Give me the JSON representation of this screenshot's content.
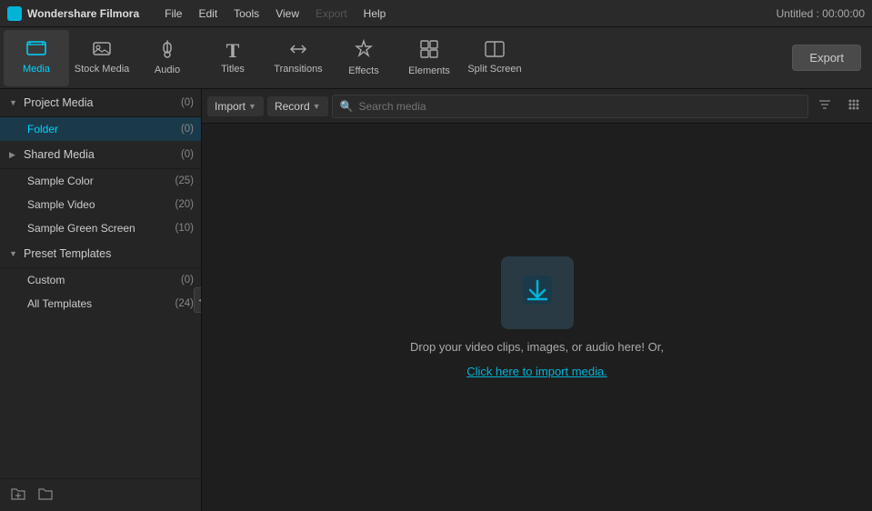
{
  "app": {
    "name": "Wondershare Filmora",
    "logo_color": "#00b4d8",
    "title": "Untitled : 00:00:00"
  },
  "menu": {
    "items": [
      "File",
      "Edit",
      "Tools",
      "View",
      "Export",
      "Help"
    ],
    "disabled": [
      "Export"
    ]
  },
  "toolbar": {
    "tools": [
      {
        "id": "media",
        "label": "Media",
        "icon": "🖥",
        "active": true
      },
      {
        "id": "stock-media",
        "label": "Stock Media",
        "icon": "📷",
        "active": false
      },
      {
        "id": "audio",
        "label": "Audio",
        "icon": "♪",
        "active": false
      },
      {
        "id": "titles",
        "label": "Titles",
        "icon": "T",
        "active": false
      },
      {
        "id": "transitions",
        "label": "Transitions",
        "icon": "↔",
        "active": false
      },
      {
        "id": "effects",
        "label": "Effects",
        "icon": "✦",
        "active": false
      },
      {
        "id": "elements",
        "label": "Elements",
        "icon": "◈",
        "active": false
      },
      {
        "id": "split-screen",
        "label": "Split Screen",
        "icon": "⊟",
        "active": false
      }
    ],
    "export_label": "Export"
  },
  "sidebar": {
    "sections": [
      {
        "id": "project-media",
        "label": "Project Media",
        "count": "(0)",
        "expanded": true,
        "items": [
          {
            "id": "folder",
            "label": "Folder",
            "count": "(0)",
            "selected": true
          }
        ]
      },
      {
        "id": "shared-media",
        "label": "Shared Media",
        "count": "(0)",
        "expanded": true,
        "items": [
          {
            "id": "sample-color",
            "label": "Sample Color",
            "count": "(25)",
            "selected": false
          },
          {
            "id": "sample-video",
            "label": "Sample Video",
            "count": "(20)",
            "selected": false
          },
          {
            "id": "sample-green-screen",
            "label": "Sample Green Screen",
            "count": "(10)",
            "selected": false
          }
        ]
      },
      {
        "id": "preset-templates",
        "label": "Preset Templates",
        "count": "",
        "expanded": true,
        "items": [
          {
            "id": "custom",
            "label": "Custom",
            "count": "(0)",
            "selected": false
          },
          {
            "id": "all-templates",
            "label": "All Templates",
            "count": "(24)",
            "selected": false
          }
        ]
      }
    ],
    "bottom_buttons": [
      "add-folder-icon",
      "new-folder-icon"
    ]
  },
  "content_toolbar": {
    "import_label": "Import",
    "record_label": "Record",
    "search_placeholder": "Search media"
  },
  "drop_zone": {
    "text": "Drop your video clips, images, or audio here! Or,",
    "link_text": "Click here to import media."
  }
}
